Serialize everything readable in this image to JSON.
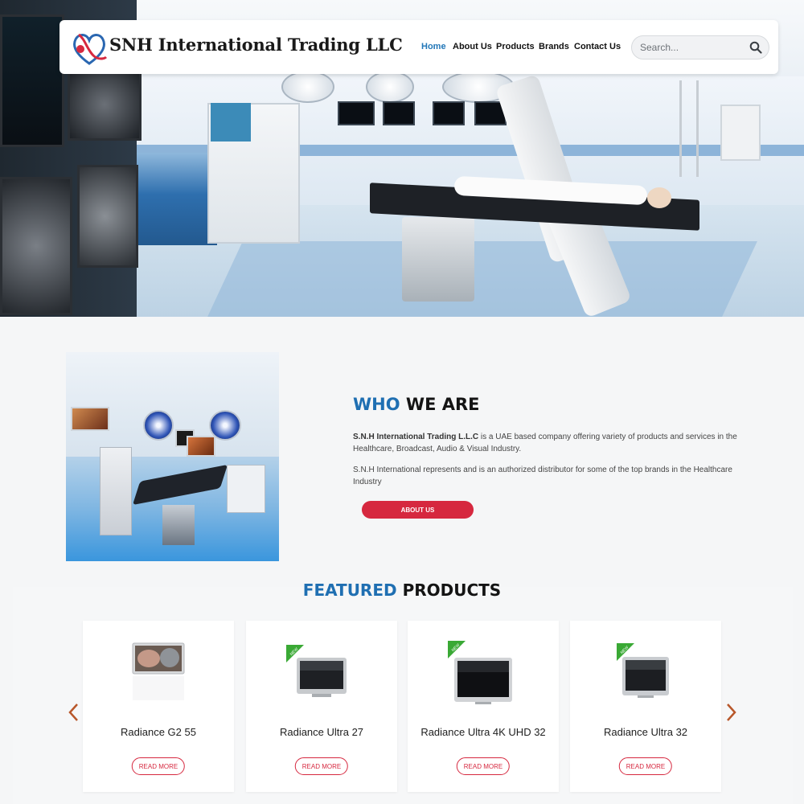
{
  "site": {
    "brand_name": "SNH International Trading LLC",
    "logo_icon": "heart-logo-icon"
  },
  "nav": {
    "items": [
      {
        "label": "Home",
        "active": true
      },
      {
        "label": "About Us",
        "active": false
      },
      {
        "label": "Products",
        "active": false
      },
      {
        "label": "Brands",
        "active": false
      },
      {
        "label": "Contact Us",
        "active": false
      }
    ],
    "search_placeholder": "Search...",
    "search_icon": "search-icon"
  },
  "who_we_are": {
    "title_accent": "WHO",
    "title_rest": "WE ARE",
    "p1_strong": "S.N.H International Trading L.L.C",
    "p1_rest": " is a UAE based company offering variety of products and services in the Healthcare, Broadcast, Audio & Visual Industry.",
    "p2": "S.N.H International represents and is an authorized distributor for some of the top brands in the Healthcare Industry",
    "button_label": "ABOUT US"
  },
  "featured": {
    "title_accent": "FEATURED",
    "title_rest": "PRODUCTS",
    "products": [
      {
        "name": "Radiance G2 55",
        "button": "READ MORE",
        "badge": ""
      },
      {
        "name": "Radiance Ultra 27",
        "button": "READ MORE",
        "badge": "NEW"
      },
      {
        "name": "Radiance Ultra 4K UHD 32",
        "button": "READ MORE",
        "badge": "NEW"
      },
      {
        "name": "Radiance Ultra 32",
        "button": "READ MORE",
        "badge": "NEW"
      }
    ],
    "prev_icon": "chevron-left-icon",
    "next_icon": "chevron-right-icon"
  },
  "colors": {
    "accent_blue": "#1f6fb2",
    "nav_active": "#2277b8",
    "brand_red": "#d6283f",
    "badge_green": "#3aa935"
  }
}
